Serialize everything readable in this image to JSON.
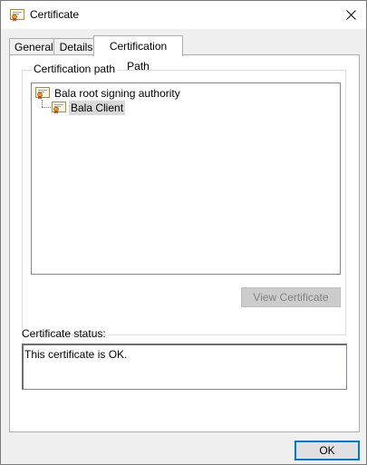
{
  "window": {
    "title": "Certificate",
    "close_label": "✕"
  },
  "tabs": [
    {
      "label": "General",
      "active": false
    },
    {
      "label": "Details",
      "active": false
    },
    {
      "label": "Certification Path",
      "active": true
    }
  ],
  "certification_path": {
    "group_label": "Certification path",
    "items": [
      {
        "label": "Bala root signing authority",
        "icon": "certificate-icon",
        "selected": false
      },
      {
        "label": "Bala Client",
        "icon": "certificate-icon",
        "selected": true
      }
    ],
    "view_button_label": "View Certificate",
    "view_button_enabled": false
  },
  "status": {
    "label": "Certificate status:",
    "text": "This certificate is OK."
  },
  "footer": {
    "ok_label": "OK"
  },
  "colors": {
    "focus_border": "#0078d7",
    "cert_ribbon": "#e0a020",
    "cert_ribbon_dark": "#c04020"
  }
}
